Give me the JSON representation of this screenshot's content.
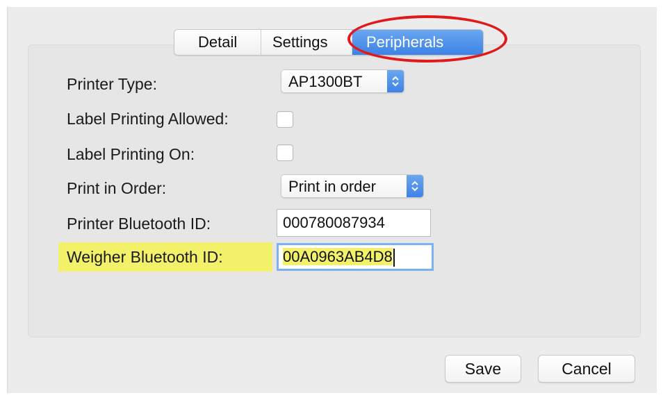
{
  "tabs": {
    "detail": "Detail",
    "settings": "Settings",
    "peripherals": "Peripherals",
    "active": "Peripherals"
  },
  "form": {
    "printer_type": {
      "label": "Printer Type:",
      "value": "AP1300BT"
    },
    "label_printing_allowed": {
      "label": "Label Printing Allowed:",
      "checked": false
    },
    "label_printing_on": {
      "label": "Label Printing On:",
      "checked": false
    },
    "print_in_order": {
      "label": "Print in Order:",
      "value": "Print in order"
    },
    "printer_bluetooth_id": {
      "label": "Printer Bluetooth ID:",
      "value": "000780087934"
    },
    "weigher_bluetooth_id": {
      "label": "Weigher Bluetooth ID:",
      "value": "00A0963AB4D8"
    }
  },
  "buttons": {
    "save": "Save",
    "cancel": "Cancel"
  },
  "icons": {
    "stepper": "up-down-chevron-icon"
  },
  "colors": {
    "accent": "#3d82e6",
    "highlight": "#f3f06a",
    "annotation": "#e01a1a"
  }
}
